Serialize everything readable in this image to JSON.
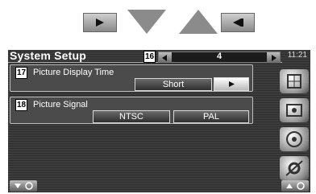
{
  "screen": {
    "title": "System Setup",
    "title_badge": "16",
    "page_value": "4",
    "clock": "11:21"
  },
  "settings": [
    {
      "badge": "17",
      "label": "Picture Display Time",
      "value": "Short"
    },
    {
      "badge": "18",
      "label": "Picture Signal",
      "options": [
        "NTSC",
        "PAL"
      ]
    }
  ],
  "icons": {
    "legend_play": "play-icon",
    "legend_down": "down-triangle-icon",
    "legend_up": "up-triangle-icon",
    "legend_back": "back-icon",
    "pager_left": "left-arrow-icon",
    "pager_right": "right-arrow-icon",
    "side_1": "menu-grid-icon",
    "side_2": "media-icon",
    "side_3": "disc-icon",
    "side_4": "settings-icon",
    "bottom_left": "chevron-down-icon",
    "bottom_right": "chevron-up-icon"
  }
}
